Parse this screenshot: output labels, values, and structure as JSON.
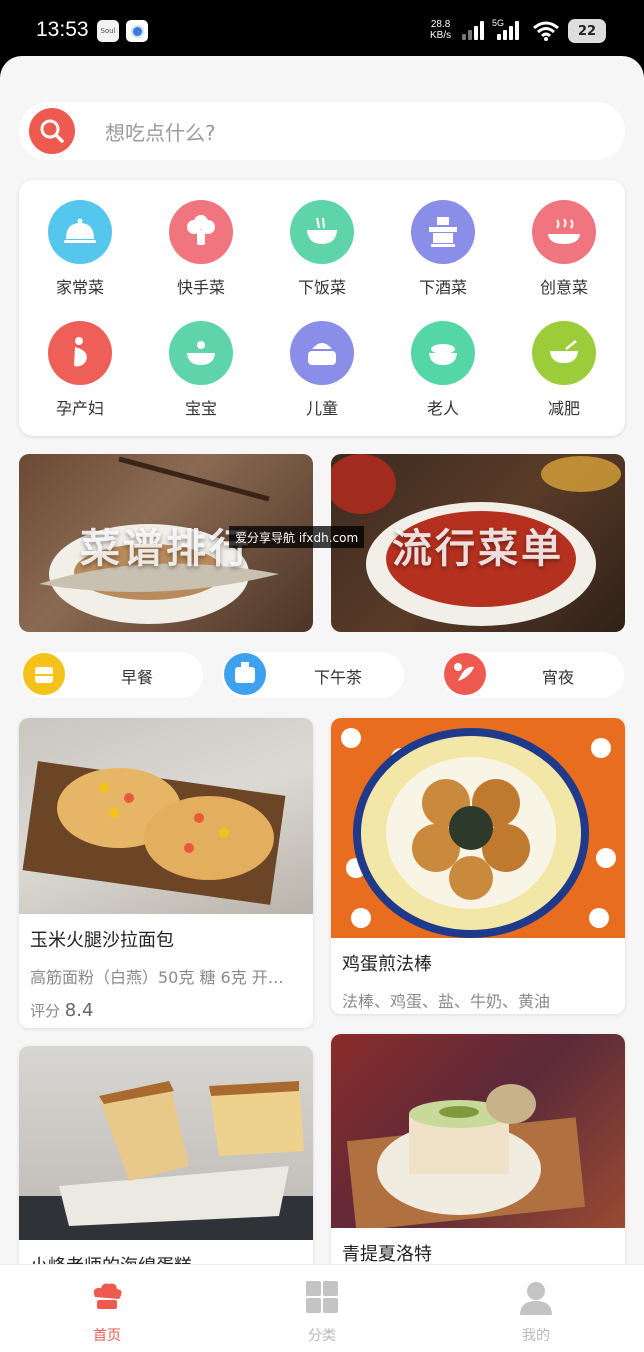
{
  "status_bar": {
    "time": "13:53",
    "app1": "Soul",
    "net_speed_value": "28.8",
    "net_speed_unit": "KB/s",
    "network": "5G",
    "battery": "22"
  },
  "search": {
    "placeholder": "想吃点什么?"
  },
  "categories": [
    {
      "label": "家常菜",
      "icon": "cloche-icon",
      "color": "#55c6ec"
    },
    {
      "label": "快手菜",
      "icon": "broccoli-icon",
      "color": "#f0757f"
    },
    {
      "label": "下饭菜",
      "icon": "rice-bowl-icon",
      "color": "#5fd3a9"
    },
    {
      "label": "下酒菜",
      "icon": "hotpot-icon",
      "color": "#8a8ee8"
    },
    {
      "label": "创意菜",
      "icon": "plate-icon",
      "color": "#f0757f"
    },
    {
      "label": "孕产妇",
      "icon": "pregnant-icon",
      "color": "#ee5f58"
    },
    {
      "label": "宝宝",
      "icon": "baby-bowl-icon",
      "color": "#5fd3a9"
    },
    {
      "label": "儿童",
      "icon": "juicer-icon",
      "color": "#8a8ee8"
    },
    {
      "label": "老人",
      "icon": "noodle-bowl-icon",
      "color": "#55d6a6"
    },
    {
      "label": "减肥",
      "icon": "salad-bowl-icon",
      "color": "#9ccc3a"
    }
  ],
  "banners": [
    {
      "text": "菜谱排行"
    },
    {
      "text": "流行菜单"
    }
  ],
  "watermark": "爱分享导航 ifxdh.com",
  "meals": [
    {
      "label": "早餐",
      "icon": "breakfast-icon",
      "color": "#f4c21b"
    },
    {
      "label": "下午茶",
      "icon": "teatime-icon",
      "color": "#3ea1f0"
    },
    {
      "label": "宵夜",
      "icon": "crayfish-icon",
      "color": "#ee5a4f"
    }
  ],
  "recipes": [
    {
      "title": "玉米火腿沙拉面包",
      "desc": "高筋面粉（白燕）50克 糖 6克 开…",
      "score_label": "评分",
      "score": "8.4"
    },
    {
      "title": "鸡蛋煎法棒",
      "desc": "法棒、鸡蛋、盐、牛奶、黄油"
    },
    {
      "title": "小峰老师的海绵蛋糕"
    },
    {
      "title": "青提夏洛特"
    }
  ],
  "tabs": [
    {
      "label": "首页",
      "icon": "chef-hat-icon"
    },
    {
      "label": "分类",
      "icon": "grid-icon"
    },
    {
      "label": "我的",
      "icon": "user-icon"
    }
  ],
  "colors": {
    "accent": "#ee5a4f",
    "background": "#f6f6f6"
  }
}
